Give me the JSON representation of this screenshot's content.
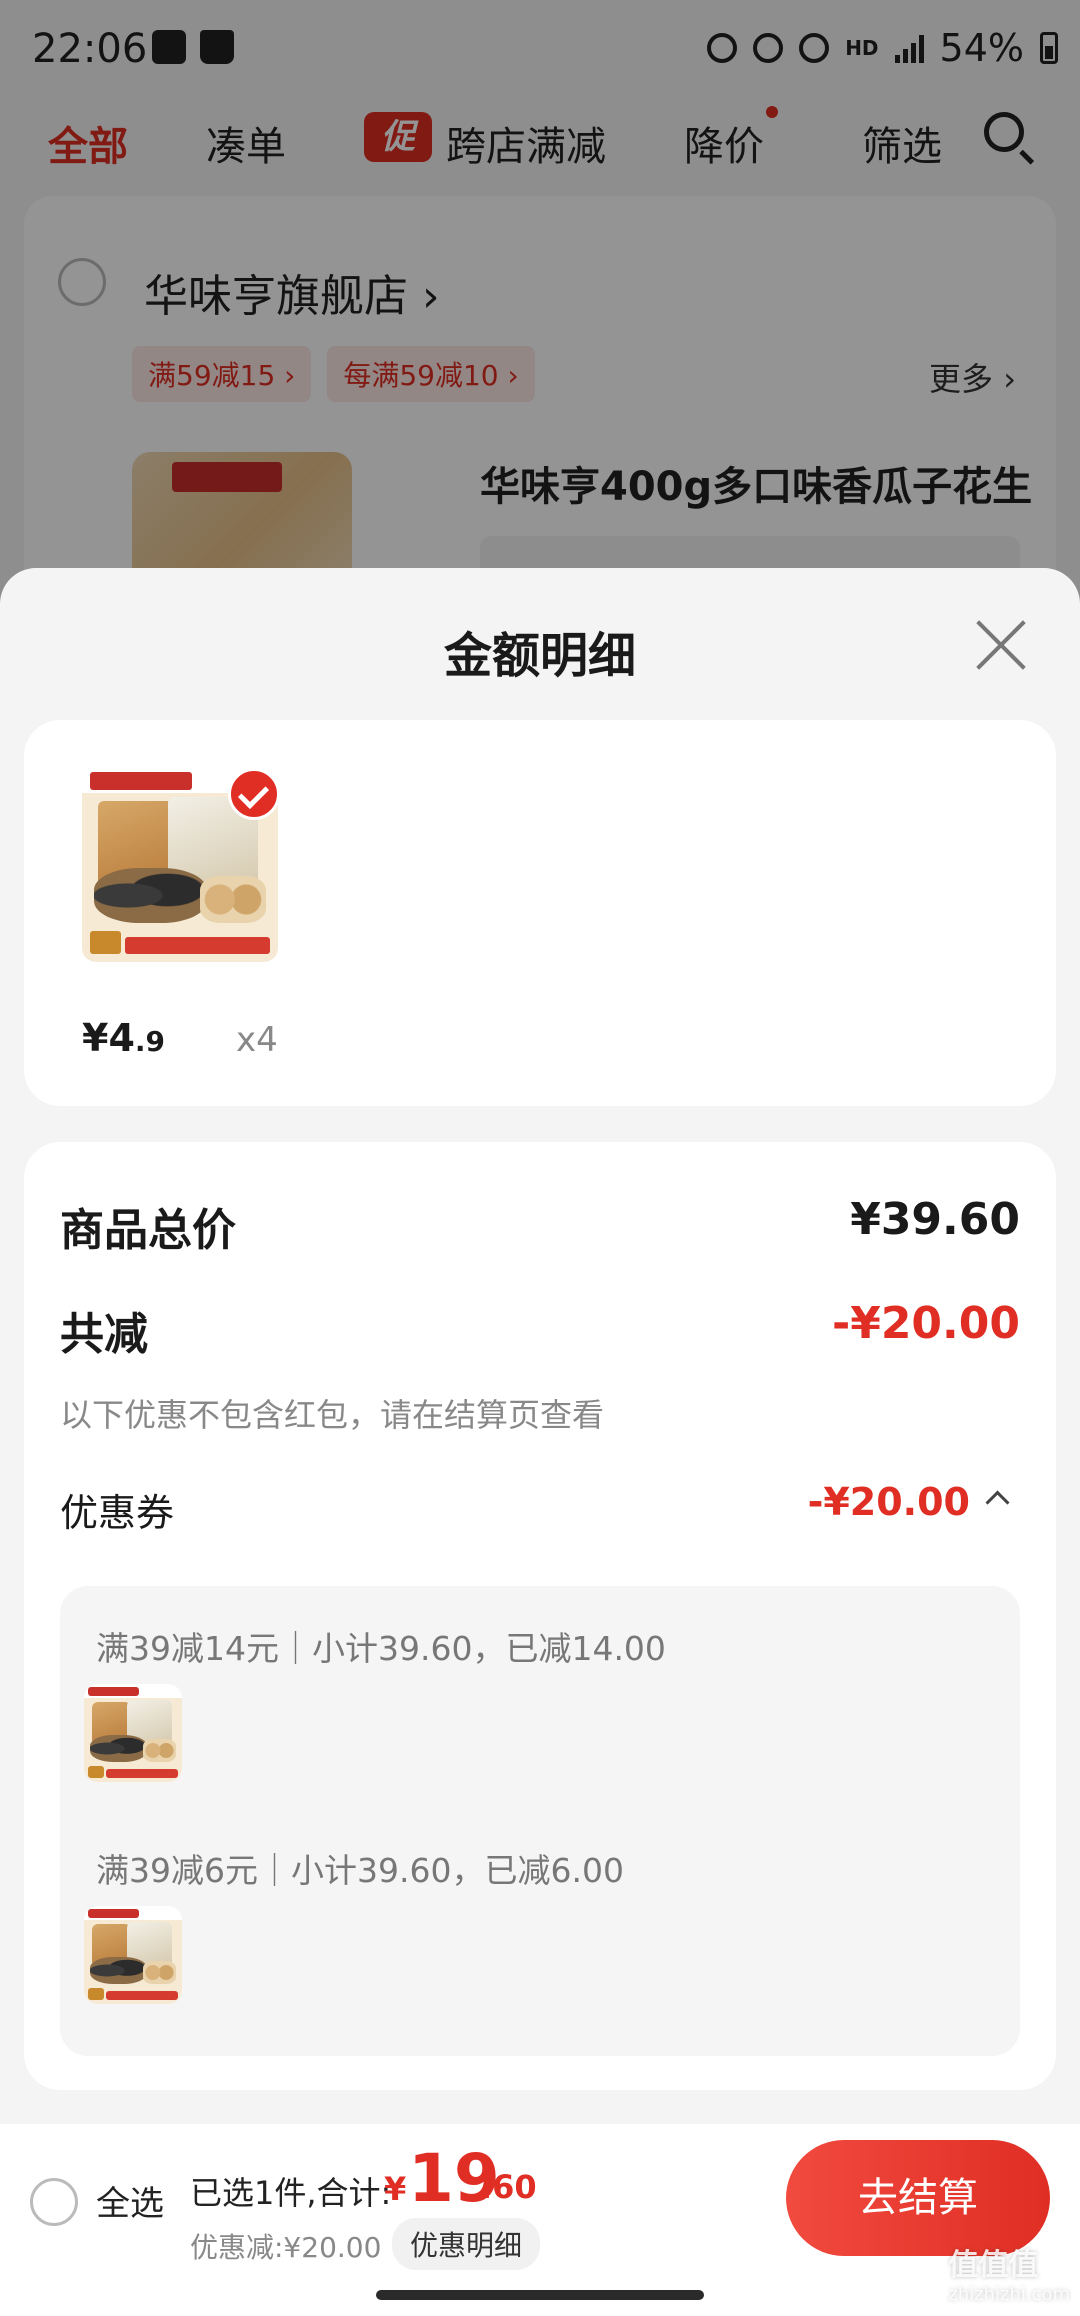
{
  "status_bar": {
    "time": "22:06",
    "battery": "54%",
    "network": "HD",
    "signal": "4G"
  },
  "filters": {
    "all": "全部",
    "combine": "凑单",
    "promo_icon": "促",
    "cross_store": "跨店满减",
    "price_drop": "降价",
    "filter": "筛选"
  },
  "store": {
    "name": "华味亨旗舰店 ›",
    "tags": [
      "满59减15 ›",
      "每满59减10 ›"
    ],
    "more": "更多 ›",
    "product_title": "华味亨400g多口味香瓜子花生"
  },
  "sheet": {
    "title": "金额明细",
    "item": {
      "price_yen": "¥4",
      "price_dec": ".9",
      "qty": "x4"
    },
    "total_label": "商品总价",
    "total_value": "¥39.60",
    "reduce_label": "共减",
    "reduce_value": "-¥20.00",
    "hint": "以下优惠不包含红包，请在结算页查看",
    "coupon_label": "优惠券",
    "coupon_value": "-¥20.00",
    "coupons": [
      {
        "line": "满39减14元｜小计39.60，已减14.00"
      },
      {
        "line": "满39减6元｜小计39.60，已减6.00"
      }
    ]
  },
  "bottom_bar": {
    "select_all": "全选",
    "summary": "已选1件,合计:",
    "total_yen": "¥",
    "total_int": "19",
    "total_dec": ".60",
    "discount": "优惠减:¥20.00",
    "detail_button": "优惠明细",
    "checkout": "去结算"
  },
  "watermark": {
    "text": "值值值",
    "site": "zhizhizhi.com"
  },
  "colors": {
    "accent": "#e02e24",
    "background": "#f4f4f4"
  }
}
